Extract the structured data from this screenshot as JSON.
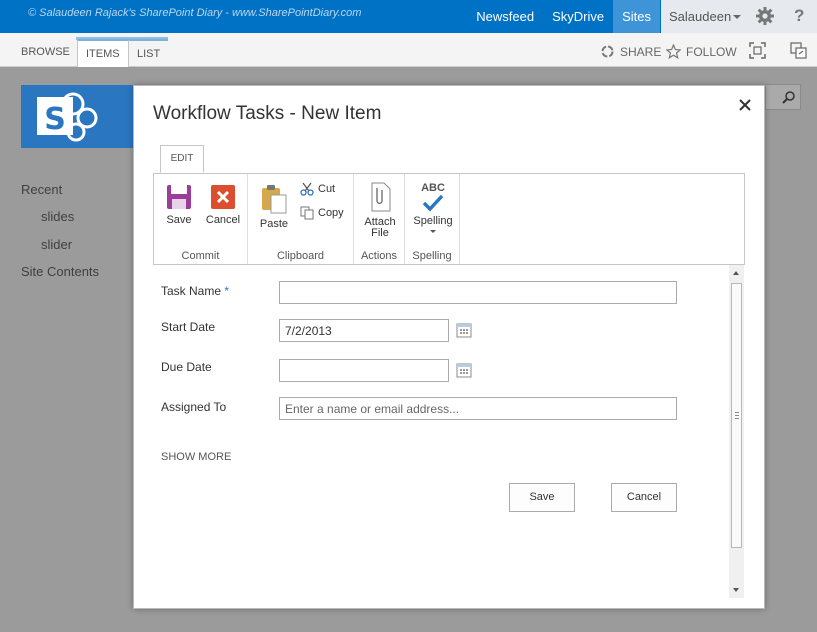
{
  "suite_bar": {
    "watermark": "© Salaudeen Rajack's SharePoint Diary - www.SharePointDiary.com",
    "nav": [
      "Newsfeed",
      "SkyDrive",
      "Sites"
    ],
    "active_nav": "Sites",
    "user": "Salaudeen",
    "help": "?",
    "colors": {
      "bar": "#0072c6",
      "active": "#3e94d6"
    }
  },
  "ribbon_tabs": {
    "browse": "BROWSE",
    "items": "ITEMS",
    "list": "LIST",
    "share": "SHARE",
    "follow": "FOLLOW"
  },
  "quick_launch": {
    "items": [
      "Recent",
      "slides",
      "slider",
      "Site Contents"
    ]
  },
  "dialog": {
    "title": "Workflow Tasks - New Item",
    "edit_tab": "EDIT",
    "ribbon": {
      "commit": {
        "label": "Commit",
        "save": "Save",
        "cancel": "Cancel"
      },
      "clipboard": {
        "label": "Clipboard",
        "paste": "Paste",
        "cut": "Cut",
        "copy": "Copy"
      },
      "actions": {
        "label": "Actions",
        "attach_line1": "Attach",
        "attach_line2": "File"
      },
      "spelling": {
        "label": "Spelling",
        "abc": "ABC",
        "spelling": "Spelling"
      }
    },
    "form": {
      "task_name_label": "Task Name",
      "required_mark": "*",
      "task_name_value": "",
      "start_date_label": "Start Date",
      "start_date_value": "7/2/2013",
      "due_date_label": "Due Date",
      "due_date_value": "",
      "assigned_to_label": "Assigned To",
      "assigned_to_placeholder": "Enter a name or email address...",
      "show_more": "SHOW MORE",
      "save": "Save",
      "cancel": "Cancel"
    }
  }
}
